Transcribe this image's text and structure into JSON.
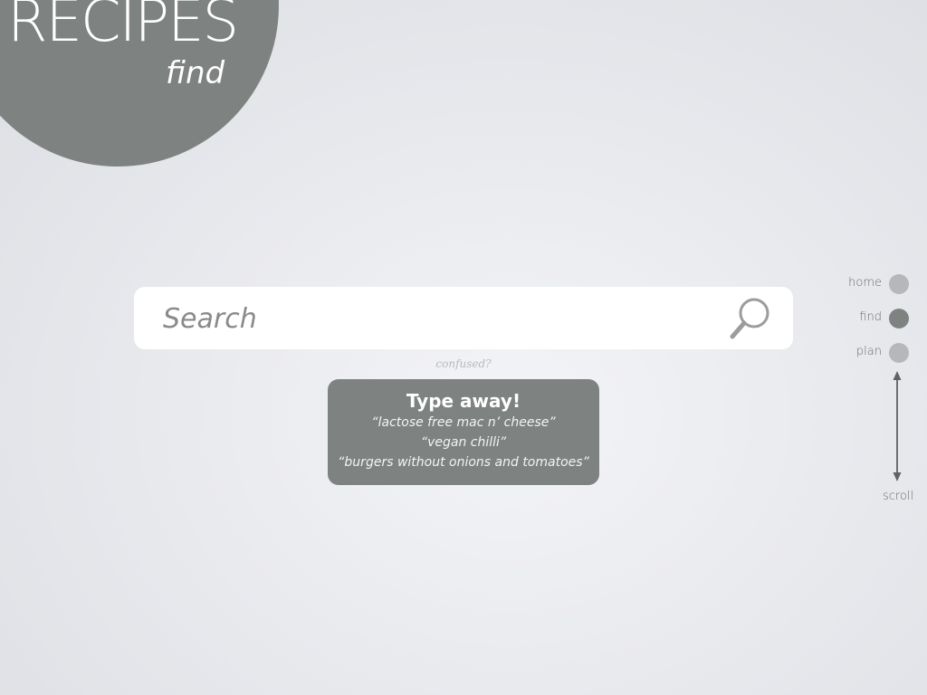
{
  "app": {
    "title": "RECIPES",
    "section": "find"
  },
  "search": {
    "placeholder": "Search",
    "value": "",
    "icon": "magnifier-icon"
  },
  "help_link": "confused?",
  "hint": {
    "title": "Type away!",
    "examples": [
      "“lactose free mac n’ cheese”",
      "“vegan chilli”",
      "“burgers without onions and tomatoes”"
    ]
  },
  "nav": {
    "items": [
      {
        "label": "home",
        "active": false
      },
      {
        "label": "find",
        "active": true
      },
      {
        "label": "plan",
        "active": false
      }
    ],
    "scroll_label": "scroll"
  },
  "colors": {
    "accent_gray": "#7e8280",
    "active_dot": "#7e8280",
    "inactive_dot": "#b6b7b9",
    "background": "#e9eaee",
    "hint_text": "#ffffff"
  }
}
